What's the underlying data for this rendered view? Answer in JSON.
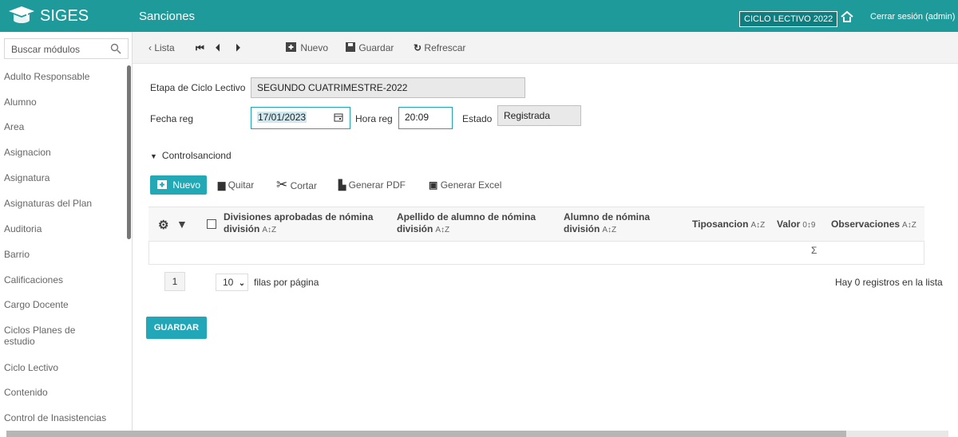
{
  "header": {
    "app_name": "SIGES",
    "page_title": "Sanciones",
    "cycle_badge": "CICLO LECTIVO 2022",
    "logout": "Cerrar sesión (admin)"
  },
  "sidebar": {
    "search_placeholder": "Buscar módulos",
    "items": [
      {
        "label": "Adulto Responsable"
      },
      {
        "label": "Alumno"
      },
      {
        "label": "Area"
      },
      {
        "label": "Asignacion"
      },
      {
        "label": "Asignatura"
      },
      {
        "label": "Asignaturas del Plan"
      },
      {
        "label": "Auditoria"
      },
      {
        "label": "Barrio"
      },
      {
        "label": "Calificaciones"
      },
      {
        "label": "Cargo Docente"
      },
      {
        "label": "Ciclos Planes de estudio"
      },
      {
        "label": "Ciclo Lectivo"
      },
      {
        "label": "Contenido"
      },
      {
        "label": "Control de Inasistencias"
      }
    ]
  },
  "toolbar": {
    "list": "Lista",
    "new": "Nuevo",
    "save": "Guardar",
    "refresh": "Refrescar"
  },
  "form": {
    "stage_label": "Etapa de Ciclo Lectivo",
    "stage_value": "SEGUNDO CUATRIMESTRE-2022",
    "date_label": "Fecha reg",
    "date_value": "17/01/2023",
    "time_label": "Hora reg",
    "time_value": "20:09",
    "status_label": "Estado",
    "status_value": "Registrada"
  },
  "section": {
    "title": "Controlsanciond",
    "actions": {
      "new": "Nuevo",
      "remove": "Quitar",
      "cut": "Cortar",
      "pdf": "Generar PDF",
      "excel": "Generar Excel"
    }
  },
  "table": {
    "columns": [
      "Divisiones aprobadas de nómina división",
      "Apellido de alumno de nómina división",
      "Alumno de nómina división",
      "Tiposancion",
      "Valor",
      "Observaciones"
    ],
    "rows": [],
    "sum_symbol": "Σ"
  },
  "pagination": {
    "current_page": "1",
    "rows_per_page": "10",
    "rows_label": "filas por página",
    "records_text": "Hay 0 registros en la lista"
  },
  "buttons": {
    "save": "GUARDAR"
  },
  "colors": {
    "accent": "#1f9a9a",
    "button": "#23a8b6",
    "active_border": "#24a3b3"
  }
}
